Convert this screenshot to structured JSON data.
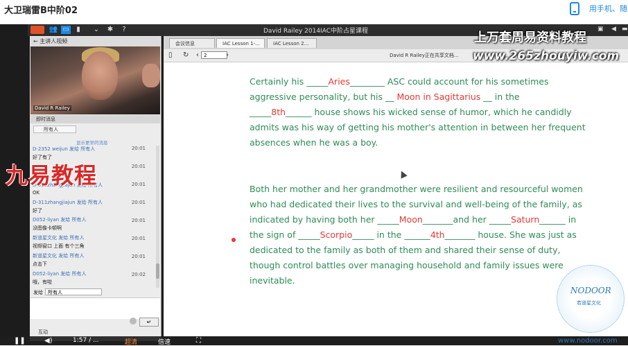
{
  "page": {
    "title": "大卫瑞雷B中阶02",
    "mobile_link": "用手机、随"
  },
  "window": {
    "title": "David  Railey  2014IAC中阶占星课程"
  },
  "left_panel": {
    "host_video_header": "主讲人视频",
    "presenter_name": "David R Railey",
    "chat_header": "即时消息",
    "chat_target": "所有人",
    "show_all": "显示更早的消息",
    "watermark": "九易教程",
    "messages": [
      {
        "sender": "D-2352 weijun 发给 所有人",
        "time": "20:01",
        "text": "好了有了"
      },
      {
        "sender": "",
        "time": "20:01",
        "text": ""
      },
      {
        "sender": "D-311zhangjiajun 发给 所有人",
        "time": "20:01",
        "text": "OK"
      },
      {
        "sender": "D-311zhangjiajun 发给 所有人",
        "time": "20:01",
        "text": "好了"
      },
      {
        "sender": "D052-liyan 发给 所有人",
        "time": "20:01",
        "text": "没图像卡顿啊"
      },
      {
        "sender": "新道星文化 发给 所有人",
        "time": "20:01",
        "text": "视频窗口 上面 有个三角"
      },
      {
        "sender": "新道星文化 发给 所有人",
        "time": "20:01",
        "text": "点击下"
      },
      {
        "sender": "D052-liyan 发给 所有人",
        "time": "20:02",
        "text": "哦，有啦"
      }
    ],
    "send_label": "发给",
    "send_target": "所有人",
    "send_button": "↵",
    "bottom_label": "互动"
  },
  "doc_tabs": [
    "会议信息",
    "IAC Lesson 1-...",
    "IAC Lesson 2..."
  ],
  "toolbar": {
    "page_value": "2",
    "share_status": "David R Railey正在共享文档..."
  },
  "document": {
    "lines": [
      [
        "Certainly his _____",
        "Aries",
        "________ ASC could account for his sometimes"
      ],
      [
        "aggressive personality, but his __ ",
        "Moon in Sagittarius",
        " __ in the"
      ],
      [
        "_____",
        "8th",
        "______ house shows his wicked sense of humor, which he candidly"
      ],
      [
        "admits was his way of getting his mother's attention in between her frequent",
        "",
        ""
      ],
      [
        "absences when he was a boy.",
        "",
        ""
      ],
      [
        "Both her mother and her grandmother were resilient and resourceful women",
        "",
        ""
      ],
      [
        "who had dedicated their lives to the survival and well-being of the family, as",
        "",
        ""
      ],
      [
        "indicated by having both her _____",
        "Moon",
        "_______and her _____",
        "Saturn",
        "______ in"
      ],
      [
        "the sign of _____",
        "Scorpio",
        "_____ in the ______",
        "4th",
        "_______ house.  She was just as"
      ],
      [
        "dedicated to the family as both of them and shared their sense of duty,",
        "",
        ""
      ],
      [
        "though control battles over managing household and family issues were",
        "",
        ""
      ],
      [
        "inevitable.",
        "",
        ""
      ]
    ]
  },
  "watermarks": {
    "line1": "上万套周易资料教程",
    "line2": "www.265zhouyiw.com"
  },
  "logo": {
    "name": "NODOOR",
    "subtitle": "若道星文化",
    "url": "www.nodoor.com"
  },
  "controls": {
    "time": "1:57 / ...",
    "quality": "超清",
    "speed": "倍速"
  },
  "colors": {
    "text_green": "#2e8b57",
    "fill_red": "#e53935",
    "link_blue": "#1e88e5"
  }
}
